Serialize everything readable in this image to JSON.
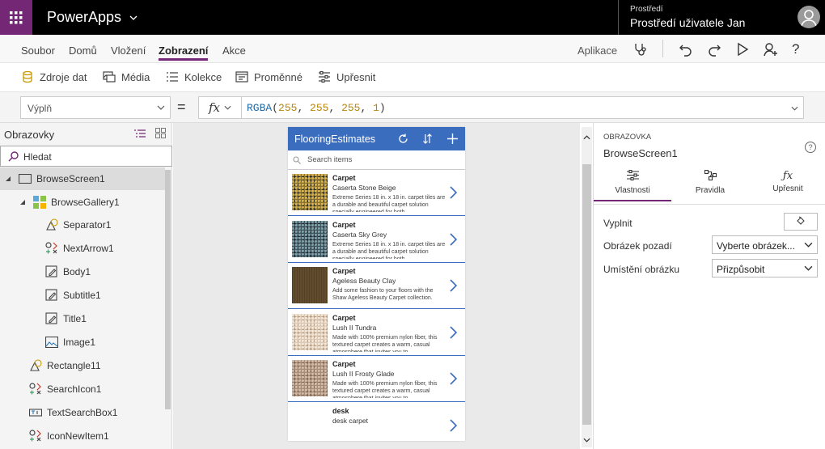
{
  "topbar": {
    "app_name": "PowerApps",
    "env_label": "Prostředí",
    "env_name": "Prostředí uživatele Jan"
  },
  "menu": {
    "items": [
      "Soubor",
      "Domů",
      "Vložení",
      "Zobrazení",
      "Akce"
    ],
    "active": "Zobrazení",
    "app_link": "Aplikace"
  },
  "toolbar": {
    "items": [
      "Zdroje dat",
      "Média",
      "Kolekce",
      "Proměnné",
      "Upřesnit"
    ]
  },
  "formula_bar": {
    "property": "Výplň",
    "equals": "=",
    "fx": "fx",
    "formula": "RGBA(255, 255, 255, 1)"
  },
  "tree": {
    "title": "Obrazovky",
    "search_placeholder": "Hledat",
    "nodes": [
      "BrowseScreen1",
      "BrowseGallery1",
      "Separator1",
      "NextArrow1",
      "Body1",
      "Subtitle1",
      "Title1",
      "Image1",
      "Rectangle11",
      "SearchIcon1",
      "TextSearchBox1",
      "IconNewItem1"
    ]
  },
  "app_preview": {
    "title": "FlooringEstimates",
    "search_placeholder": "Search items",
    "items": [
      {
        "title": "Carpet",
        "subtitle": "Caserta Stone Beige",
        "body": "Extreme Series 18 in. x 18 in. carpet tiles are a durable and beautiful carpet solution specially engineered for both"
      },
      {
        "title": "Carpet",
        "subtitle": "Caserta Sky Grey",
        "body": "Extreme Series 18 in. x 18 in. carpet tiles are a durable and beautiful carpet solution specially engineered for both"
      },
      {
        "title": "Carpet",
        "subtitle": "Ageless Beauty Clay",
        "body": "Add some fashion to your floors with the Shaw Ageless Beauty Carpet collection."
      },
      {
        "title": "Carpet",
        "subtitle": "Lush II Tundra",
        "body": "Made with 100% premium nylon fiber, this textured carpet creates a warm, casual atmosphere that invites you to"
      },
      {
        "title": "Carpet",
        "subtitle": "Lush II Frosty Glade",
        "body": "Made with 100% premium nylon fiber, this textured carpet creates a warm, casual atmosphere that invites you to"
      },
      {
        "title": "desk",
        "subtitle": "desk carpet",
        "body": ""
      }
    ]
  },
  "properties": {
    "section_label": "OBRAZOVKA",
    "screen_name": "BrowseScreen1",
    "tabs": [
      "Vlastnosti",
      "Pravidla",
      "Upřesnit"
    ],
    "active_tab": "Vlastnosti",
    "fill_label": "Vyplnit",
    "bg_image_label": "Obrázek pozadí",
    "bg_image_value": "Vyberte obrázek...",
    "image_position_label": "Umístění obrázku",
    "image_position_value": "Přizpůsobit"
  },
  "colors": {
    "brand": "#742774",
    "app_header": "#3b6dbf",
    "formula_number": "#b8860b",
    "formula_function": "#1e6aa8"
  }
}
